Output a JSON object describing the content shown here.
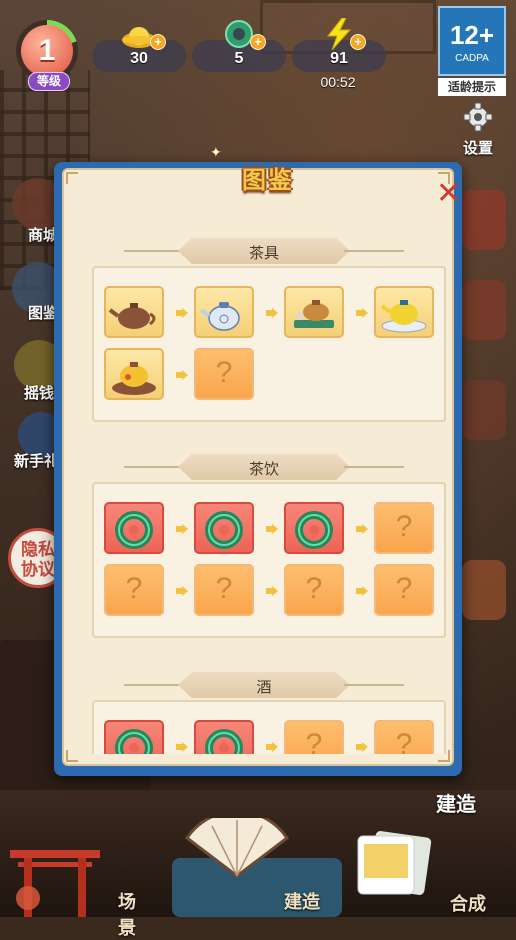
{
  "hud": {
    "level": "1",
    "level_label": "等级",
    "gold": "30",
    "jade": "5",
    "energy": "91",
    "energy_timer": "00:52",
    "age_rating": "12+",
    "age_org": "CADPA",
    "age_tip": "适龄提示",
    "settings_label": "设置"
  },
  "side": {
    "shop": "商城",
    "codex": "图鉴",
    "lottery": "摇钱",
    "newbie": "新手礼",
    "privacy": "隐私\n协议",
    "build": "建造"
  },
  "modal": {
    "title": "图鉴",
    "sections": [
      {
        "title": "茶具"
      },
      {
        "title": "茶饮"
      },
      {
        "title": "酒"
      }
    ]
  },
  "bottom_nav": {
    "scene": "场景",
    "build": "建造",
    "merge": "合成"
  },
  "colors": {
    "modal_border": "#2c6bb0",
    "parchment": "#f6ecd6",
    "tile_yellow": "#f5cf75",
    "tile_red": "#ec6556",
    "tile_unknown": "#f9a54c"
  }
}
